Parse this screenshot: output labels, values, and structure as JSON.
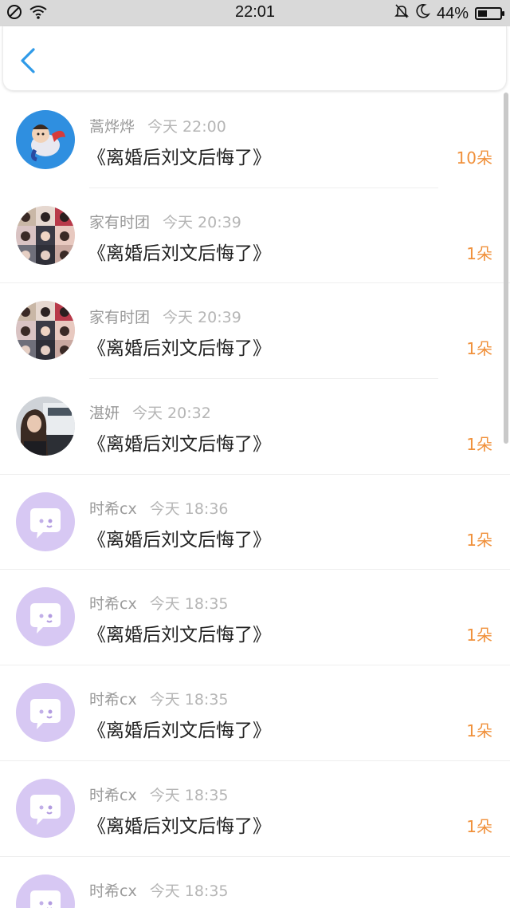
{
  "status_bar": {
    "time": "22:01",
    "battery_percent_text": "44%",
    "battery_level": 0.44
  },
  "header": {
    "back_icon": "chevron-left-icon"
  },
  "colors": {
    "accent_blue": "#2f9ae8",
    "count_orange": "#f0903a",
    "placeholder_purple": "#d7c8f3"
  },
  "items": [
    {
      "user": "蒿烨烨",
      "time": "今天 22:00",
      "book": "《离婚后刘文后悔了》",
      "count": "10朵",
      "avatar": "cartoon-avatar"
    },
    {
      "user": "家有时团",
      "time": "今天 20:39",
      "book": "《离婚后刘文后悔了》",
      "count": "1朵",
      "avatar": "collage-avatar"
    },
    {
      "user": "家有时团",
      "time": "今天 20:39",
      "book": "《离婚后刘文后悔了》",
      "count": "1朵",
      "avatar": "collage-avatar"
    },
    {
      "user": "湛妍",
      "time": "今天 20:32",
      "book": "《离婚后刘文后悔了》",
      "count": "1朵",
      "avatar": "photo-avatar"
    },
    {
      "user": "时希cx",
      "time": "今天 18:36",
      "book": "《离婚后刘文后悔了》",
      "count": "1朵",
      "avatar": "default-avatar"
    },
    {
      "user": "时希cx",
      "time": "今天 18:35",
      "book": "《离婚后刘文后悔了》",
      "count": "1朵",
      "avatar": "default-avatar"
    },
    {
      "user": "时希cx",
      "time": "今天 18:35",
      "book": "《离婚后刘文后悔了》",
      "count": "1朵",
      "avatar": "default-avatar"
    },
    {
      "user": "时希cx",
      "time": "今天 18:35",
      "book": "《离婚后刘文后悔了》",
      "count": "1朵",
      "avatar": "default-avatar"
    },
    {
      "user": "时希cx",
      "time": "今天 18:35",
      "book": "",
      "count": "",
      "avatar": "default-avatar"
    }
  ]
}
